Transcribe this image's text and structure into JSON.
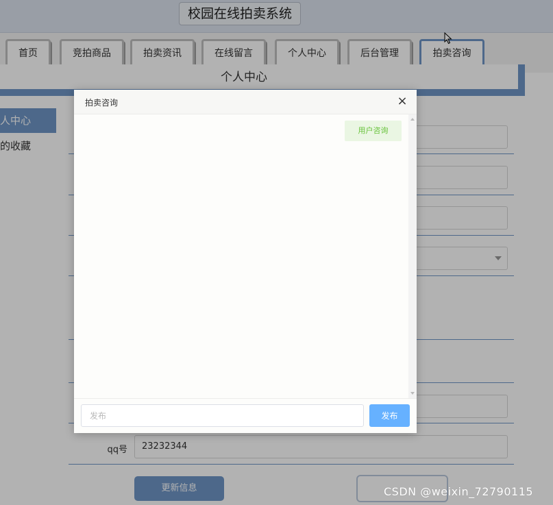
{
  "site": {
    "title": "校园在线拍卖系统"
  },
  "nav": {
    "items": [
      {
        "label": "首页"
      },
      {
        "label": "竞拍商品"
      },
      {
        "label": "拍卖资讯"
      },
      {
        "label": "在线留言"
      },
      {
        "label": "个人中心"
      },
      {
        "label": "后台管理"
      },
      {
        "label": "拍卖咨询"
      }
    ],
    "active_index": 6
  },
  "banner": {
    "text": "个人中心"
  },
  "sidebar": {
    "items": [
      {
        "label": "人中心"
      },
      {
        "label": "的收藏"
      }
    ]
  },
  "form": {
    "qq_label": "qq号",
    "qq_value": "23232344",
    "update_label": "更新信息"
  },
  "dialog": {
    "title": "拍卖咨询",
    "close_icon": "×",
    "message": "用户咨询",
    "input_placeholder": "发布",
    "send_label": "发布"
  },
  "watermark": "CSDN @weixin_72790115",
  "colors": {
    "accent": "#6f96c6",
    "send_button": "#66b1ff",
    "message_bg": "#eaf6e3",
    "message_text": "#67c23a"
  }
}
